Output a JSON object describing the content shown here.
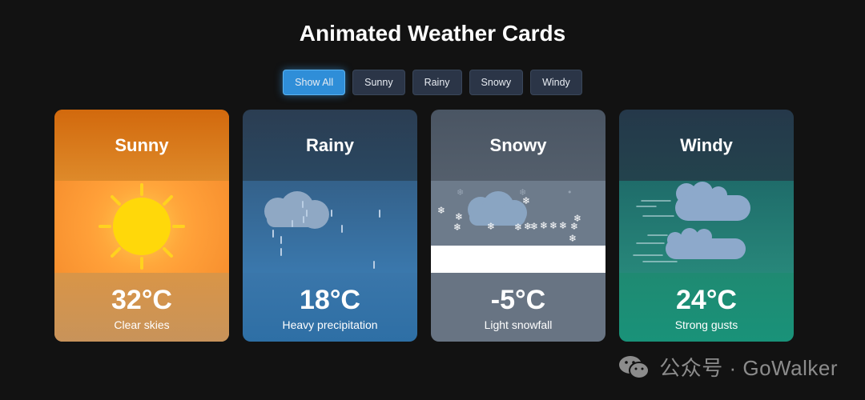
{
  "page": {
    "title": "Animated Weather Cards"
  },
  "filters": [
    {
      "label": "Show All",
      "active": true
    },
    {
      "label": "Sunny",
      "active": false
    },
    {
      "label": "Rainy",
      "active": false
    },
    {
      "label": "Snowy",
      "active": false
    },
    {
      "label": "Windy",
      "active": false
    }
  ],
  "cards": [
    {
      "title": "Sunny",
      "temp": "32°C",
      "desc": "Clear skies",
      "icon": "sun-icon"
    },
    {
      "title": "Rainy",
      "temp": "18°C",
      "desc": "Heavy precipitation",
      "icon": "rain-cloud-icon"
    },
    {
      "title": "Snowy",
      "temp": "-5°C",
      "desc": "Light snowfall",
      "icon": "snow-cloud-icon"
    },
    {
      "title": "Windy",
      "temp": "24°C",
      "desc": "Strong gusts",
      "icon": "wind-clouds-icon"
    }
  ],
  "watermark": {
    "text": "公众号 · GoWalker",
    "icon": "wechat-icon"
  },
  "colors": {
    "accent": "#2f8ed8",
    "background": "#121212",
    "sunny": "#ff9f38",
    "rainy": "#3a78ad",
    "snowy": "#6d7b8b",
    "windy": "#1f8a72"
  }
}
